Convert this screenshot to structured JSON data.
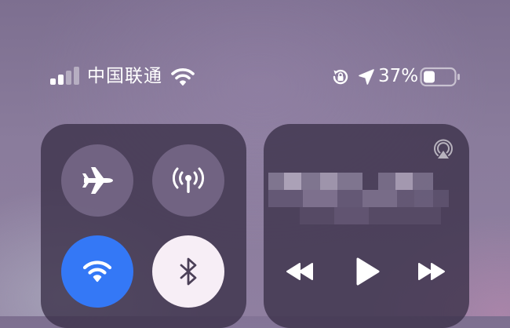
{
  "status_bar": {
    "carrier": "中国联通",
    "battery_percent": "37%",
    "signal_bars_active": 2,
    "signal_bars_total": 4,
    "battery_level": 0.37,
    "icons": [
      "signal-icon",
      "wifi-icon",
      "rotation-lock-icon",
      "location-icon",
      "battery-icon"
    ]
  },
  "connectivity": {
    "airplane_mode": false,
    "cellular_data": false,
    "wifi": true,
    "bluetooth": true,
    "icons": [
      "airplane-icon",
      "cellular-antenna-icon",
      "wifi-icon",
      "bluetooth-icon"
    ]
  },
  "media": {
    "track_title": "",
    "icons": [
      "airplay-icon",
      "rewind-icon",
      "play-icon",
      "fast-forward-icon"
    ]
  },
  "colors": {
    "wifi_active": "#3478f6",
    "bluetooth_active": "#f7eef6",
    "tile_inactive": "#786a8a",
    "panel": "#3a3048"
  }
}
